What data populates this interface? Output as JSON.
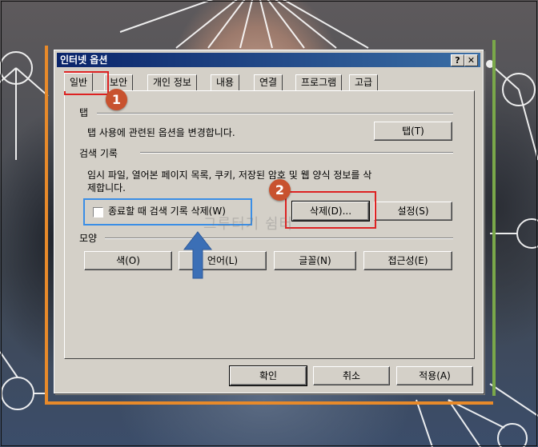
{
  "dialog": {
    "title": "인터넷 옵션",
    "help_button": "?",
    "close_button": "✕"
  },
  "tabs": [
    {
      "label": "일반",
      "active": true
    },
    {
      "label": "보안"
    },
    {
      "label": "개인 정보"
    },
    {
      "label": "내용"
    },
    {
      "label": "연결"
    },
    {
      "label": "프로그램"
    },
    {
      "label": "고급"
    }
  ],
  "tab_section": {
    "heading": "탭",
    "description": "탭 사용에 관련된 옵션을 변경합니다.",
    "button": "탭(T)"
  },
  "history_section": {
    "heading": "검색 기록",
    "description_line1": "임시 파일, 열어본 페이지 목록, 쿠키, 저장된 암호 및 웹 양식 정보를 삭",
    "description_line2": "제합니다.",
    "checkbox_label": "종료할 때 검색 기록 삭제(W)",
    "checkbox_checked": false,
    "delete_button": "삭제(D)...",
    "settings_button": "설정(S)"
  },
  "appearance_section": {
    "heading": "모양",
    "buttons": [
      "색(O)",
      "언어(L)",
      "글꼴(N)",
      "접근성(E)"
    ]
  },
  "footer": {
    "ok": "확인",
    "cancel": "취소",
    "apply": "적용(A)"
  },
  "annotations": {
    "step1": "1",
    "step2": "2",
    "watermark": "그루터기 쉼터",
    "highlight_red": "#dd2222",
    "highlight_blue": "#3a8ee6",
    "badge_color": "#c8522f",
    "arrow_color": "#3b6fb6"
  }
}
